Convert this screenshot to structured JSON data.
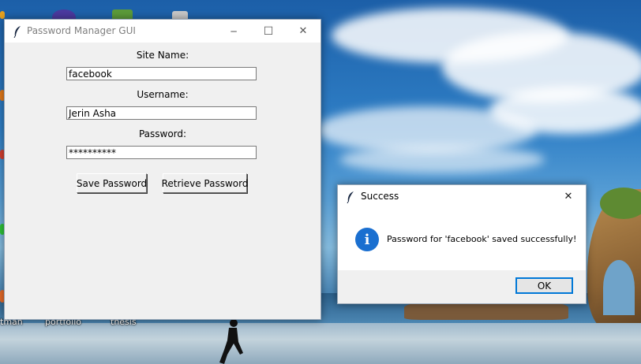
{
  "desktop": {
    "labels": [
      "tman",
      "portfolio",
      "thesis"
    ]
  },
  "main_window": {
    "title": "Password Manager GUI",
    "fields": [
      {
        "label": "Site Name:",
        "value": "facebook"
      },
      {
        "label": "Username:",
        "value": "Jerin Asha"
      },
      {
        "label": "Password:",
        "value": "**********"
      }
    ],
    "buttons": {
      "save": "Save Password",
      "retrieve": "Retrieve Password"
    },
    "controls": {
      "minimize": "─",
      "maximize": "☐",
      "close": "✕"
    }
  },
  "dialog": {
    "title": "Success",
    "message": "Password for 'facebook' saved successfully!",
    "icon": "info-icon",
    "icon_glyph": "i",
    "ok_label": "OK",
    "close": "✕"
  },
  "colors": {
    "accent": "#0078d7",
    "info_icon": "#1a6fd0",
    "window_bg": "#f0f0f0"
  }
}
